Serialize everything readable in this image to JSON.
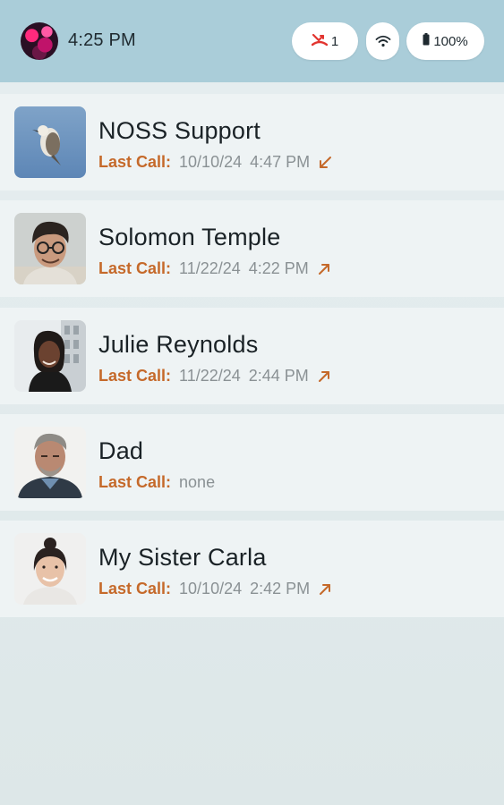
{
  "status_bar": {
    "time": "4:25 PM",
    "missed_calls": "1",
    "battery": "100%"
  },
  "contacts": [
    {
      "name": "NOSS Support",
      "last_call_label": "Last Call:",
      "date": "10/10/24",
      "time": "4:47 PM",
      "direction_icon": "incoming-call-arrow-icon"
    },
    {
      "name": "Solomon Temple",
      "last_call_label": "Last Call:",
      "date": "11/22/24",
      "time": "4:22 PM",
      "direction_icon": "outgoing-call-arrow-icon"
    },
    {
      "name": "Julie Reynolds",
      "last_call_label": "Last Call:",
      "date": "11/22/24",
      "time": "2:44 PM",
      "direction_icon": "outgoing-call-arrow-icon"
    },
    {
      "name": "Dad",
      "last_call_label": "Last Call:",
      "date": "none",
      "time": "",
      "direction_icon": ""
    },
    {
      "name": "My Sister Carla",
      "last_call_label": "Last Call:",
      "date": "10/10/24",
      "time": "2:42 PM",
      "direction_icon": "outgoing-call-arrow-icon"
    }
  ],
  "colors": {
    "status_bar_bg": "#aacdd9",
    "accent": "#c5692a",
    "row_bg": "#eef3f4",
    "missed_call_red": "#e2342f"
  }
}
